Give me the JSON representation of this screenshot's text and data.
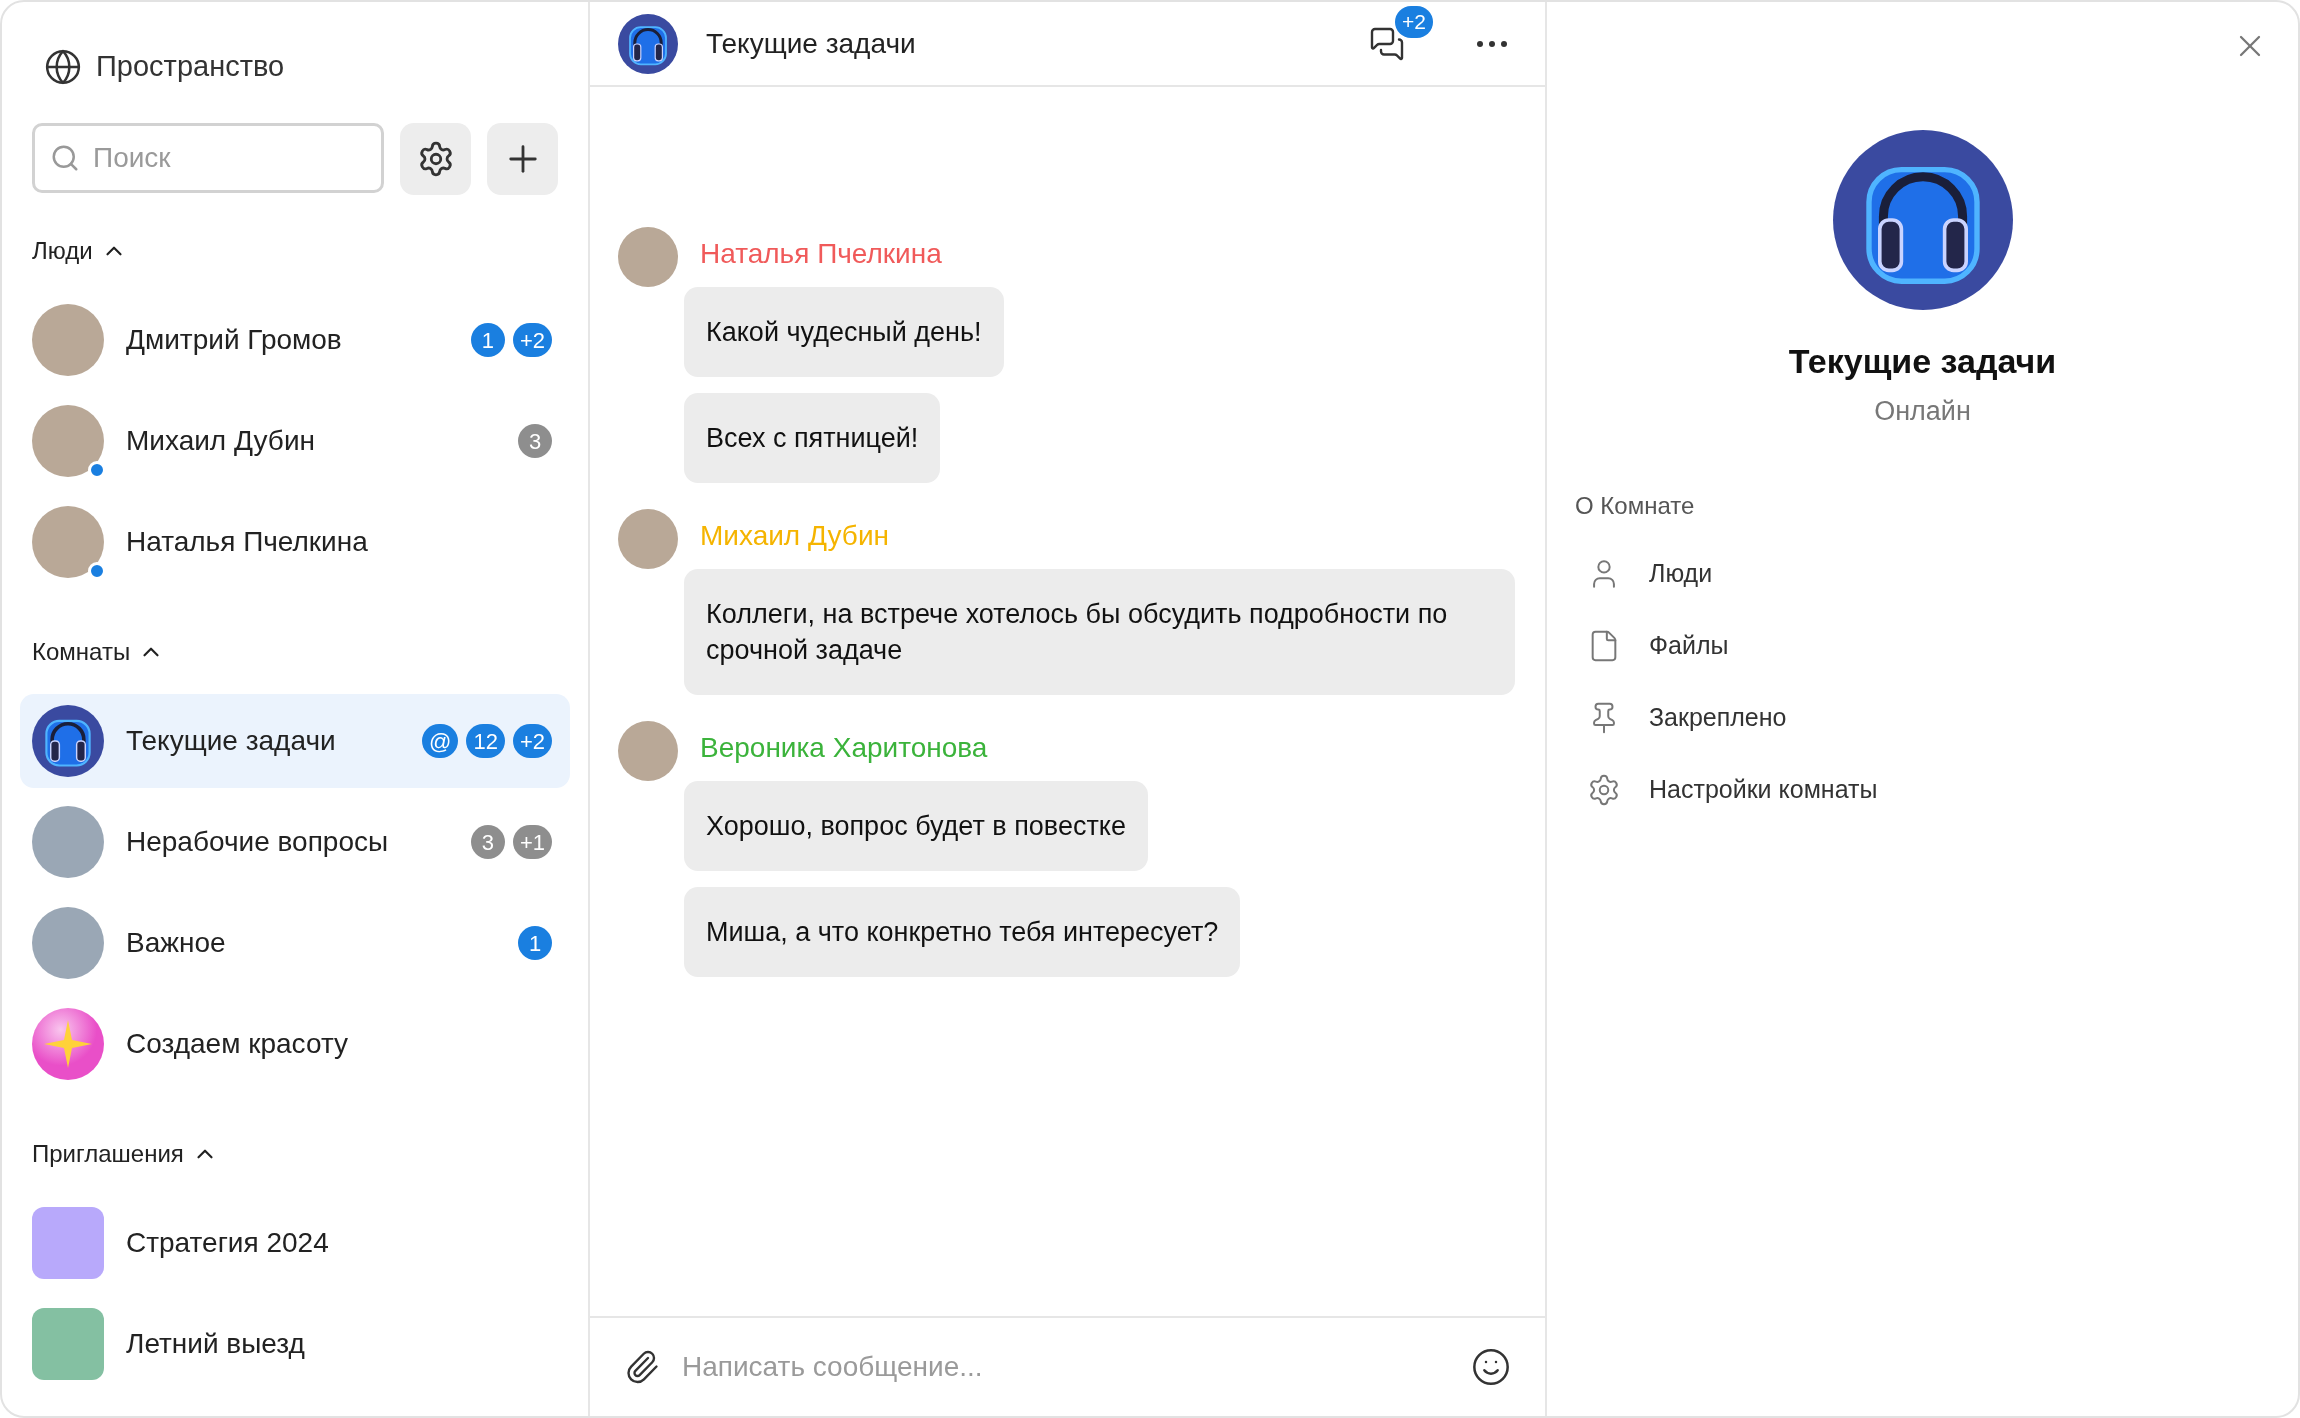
{
  "sidebar": {
    "title": "Пространство",
    "search": {
      "placeholder": "Поиск"
    },
    "sections": [
      {
        "title": "Люди",
        "expanded": true,
        "kind": "people",
        "items": [
          {
            "name": "Дмитрий Громов",
            "online": false,
            "selected": false,
            "badges": [
              {
                "text": "1",
                "color": "#1a7fe0"
              },
              {
                "text": "+2",
                "color": "#1a7fe0"
              }
            ]
          },
          {
            "name": "Михаил Дубин",
            "online": true,
            "selected": false,
            "badges": [
              {
                "text": "3",
                "color": "#8e8e8e"
              }
            ]
          },
          {
            "name": "Наталья Пчелкина",
            "online": true,
            "selected": false
          }
        ]
      },
      {
        "title": "Комнаты",
        "expanded": true,
        "kind": "rooms",
        "items": [
          {
            "name": "Текущие задачи",
            "kind": "headphones",
            "selected": true,
            "badges": [
              {
                "text": "@",
                "color": "#1a7fe0"
              },
              {
                "text": "12",
                "color": "#1a7fe0"
              },
              {
                "text": "+2",
                "color": "#1a7fe0"
              }
            ]
          },
          {
            "name": "Нерабочие вопросы",
            "kind": "photo",
            "selected": false,
            "badges": [
              {
                "text": "3",
                "color": "#8e8e8e"
              },
              {
                "text": "+1",
                "color": "#8e8e8e"
              }
            ]
          },
          {
            "name": "Важное",
            "kind": "photo",
            "selected": false,
            "badges": [
              {
                "text": "1",
                "color": "#1a7fe0"
              }
            ]
          },
          {
            "name": "Создаем красоту",
            "kind": "star",
            "selected": false
          }
        ]
      },
      {
        "title": "Приглашения",
        "expanded": true,
        "kind": "invites",
        "items": [
          {
            "name": "Стратегия 2024",
            "color": "#b8a9fb"
          },
          {
            "name": "Летний выезд",
            "color": "#84c0a2"
          }
        ]
      }
    ]
  },
  "chat": {
    "title": "Текущие задачи",
    "threads_badge": "+2",
    "groups": [
      {
        "author": "Наталья Пчелкина",
        "color": "#f05a5a",
        "messages": [
          "Какой чудесный день!",
          "Всех с пятницей!"
        ]
      },
      {
        "author": "Михаил Дубин",
        "color": "#f5b400",
        "messages": [
          "Коллеги, на встрече хотелось бы обсудить подробности по срочной задаче"
        ]
      },
      {
        "author": "Вероника Харитонова",
        "color": "#3bb33b",
        "messages": [
          "Хорошо, вопрос будет в повестке",
          "Миша, а что конкретно тебя интересует?"
        ]
      }
    ],
    "composer": {
      "placeholder": "Написать сообщение..."
    }
  },
  "details": {
    "title": "Текущие задачи",
    "status": "Онлайн",
    "section": "О Комнате",
    "items": [
      {
        "kind": "people",
        "label": "Люди"
      },
      {
        "kind": "files",
        "label": "Файлы"
      },
      {
        "kind": "pinned",
        "label": "Закреплено"
      },
      {
        "kind": "settings",
        "label": "Настройки комнаты"
      }
    ]
  }
}
